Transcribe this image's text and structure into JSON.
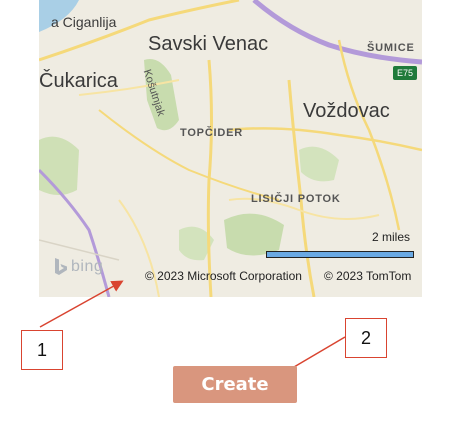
{
  "map": {
    "places": {
      "ciganlija": "a Ciganlija",
      "savski_venac": "Savski Venac",
      "sumice": "ŠUMICE",
      "cukarica": "Čukarica",
      "kosutnjak": "Košutnjak",
      "vozdovac": "Voždovac",
      "topcider": "TOPČIDER",
      "lisicji_potok": "LISIČJI POTOK"
    },
    "road_shield": "E75",
    "scale_label": "2 miles",
    "logo_text": "bing",
    "copyright_microsoft": "© 2023 Microsoft Corporation",
    "copyright_tomtom": "© 2023 TomTom",
    "colors": {
      "water": "#a9cfe6",
      "park": "#c8dcae",
      "road_major": "#f5d97a",
      "motorway": "#b39ad9"
    }
  },
  "annotations": {
    "callout_1": "1",
    "callout_2": "2",
    "color": "#d94430"
  },
  "create_button": {
    "label": "Create",
    "color": "#d9967e"
  }
}
